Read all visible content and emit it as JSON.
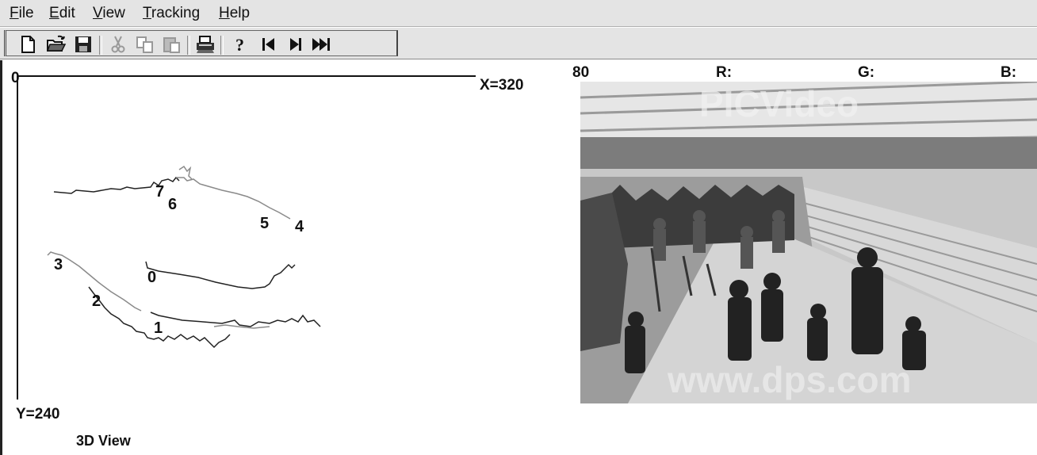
{
  "menu": {
    "file_first": "F",
    "file_rest": "ile",
    "edit_first": "E",
    "edit_rest": "dit",
    "view_first": "V",
    "view_rest": "iew",
    "tracking_first": "T",
    "tracking_rest": "racking",
    "help_first": "H",
    "help_rest": "elp"
  },
  "toolbar": {
    "icons": [
      "new-file-icon",
      "open-folder-icon",
      "save-icon",
      "cut-icon",
      "copy-icon",
      "paste-icon",
      "print-icon",
      "help-icon",
      "skip-back-icon",
      "step-forward-icon",
      "fast-forward-icon"
    ]
  },
  "tracking_view": {
    "origin_label": "0",
    "x_axis_label": "X=320",
    "y_axis_label": "Y=240",
    "panel_title": "3D View",
    "track_labels": [
      "0",
      "1",
      "2",
      "3",
      "4",
      "5",
      "6",
      "7"
    ]
  },
  "video_panel": {
    "frame_number": "80",
    "r_label": "R:",
    "g_label": "G:",
    "b_label": "B:",
    "watermark_top": "PICVideo",
    "watermark_bottom": "www.dps.com"
  },
  "colors": {
    "chrome": "#e4e4e4",
    "track_dark": "#222222",
    "track_light": "#8a8a8a"
  }
}
